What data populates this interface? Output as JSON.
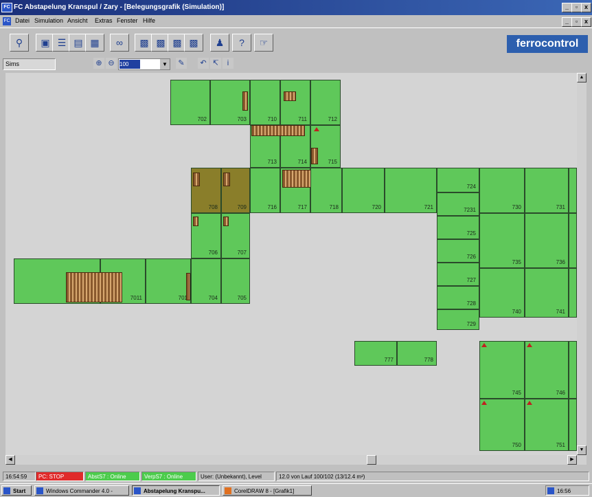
{
  "window": {
    "icon_text": "FC",
    "title": "FC Abstapelung Kranspul / Zary - [Belegungsgrafik (Simulation)]",
    "min_label": "_",
    "max_label": "▫",
    "close_label": "x"
  },
  "menu": {
    "items": [
      "Datei",
      "Simulation",
      "Ansicht",
      "Extras",
      "Fenster",
      "Hilfe"
    ],
    "icon_text": "FC"
  },
  "toolbar": {
    "brand": "ferrocontrol",
    "icons": [
      "search-icon",
      "open-icon",
      "list-icon",
      "print-icon",
      "view-icon",
      "glasses-icon",
      "grid-icon",
      "grid-icon-2",
      "grid-icon-3",
      "grid-icon-4",
      "person-icon",
      "help-icon",
      "exit-icon"
    ]
  },
  "toolbar2": {
    "view_name": "Sims",
    "zoom_value": "100",
    "zoom_dropdown": "▼",
    "icons": [
      "zoom-in-icon",
      "zoom-out-icon",
      "pen-icon",
      "undo-icon",
      "path-icon",
      "info-icon"
    ]
  },
  "cells": [
    {
      "id": "702",
      "label": "702"
    },
    {
      "id": "703",
      "label": "703"
    },
    {
      "id": "710",
      "label": "710"
    },
    {
      "id": "711",
      "label": "711"
    },
    {
      "id": "712",
      "label": "712"
    },
    {
      "id": "713",
      "label": "713"
    },
    {
      "id": "714",
      "label": "714"
    },
    {
      "id": "715",
      "label": "715"
    },
    {
      "id": "708",
      "label": "708"
    },
    {
      "id": "709",
      "label": "709"
    },
    {
      "id": "716",
      "label": "716"
    },
    {
      "id": "717",
      "label": "717"
    },
    {
      "id": "718",
      "label": "718"
    },
    {
      "id": "720",
      "label": "720"
    },
    {
      "id": "721",
      "label": "721"
    },
    {
      "id": "706",
      "label": "706"
    },
    {
      "id": "707",
      "label": "707"
    },
    {
      "id": "7011",
      "label": "7011"
    },
    {
      "id": "701",
      "label": "701"
    },
    {
      "id": "704",
      "label": "704"
    },
    {
      "id": "705",
      "label": "705"
    },
    {
      "id": "724",
      "label": "724"
    },
    {
      "id": "7231",
      "label": "7231"
    },
    {
      "id": "725",
      "label": "725"
    },
    {
      "id": "726",
      "label": "726"
    },
    {
      "id": "727",
      "label": "727"
    },
    {
      "id": "728",
      "label": "728"
    },
    {
      "id": "729",
      "label": "729"
    },
    {
      "id": "730",
      "label": "730"
    },
    {
      "id": "731",
      "label": "731"
    },
    {
      "id": "735",
      "label": "735"
    },
    {
      "id": "736",
      "label": "736"
    },
    {
      "id": "740",
      "label": "740"
    },
    {
      "id": "741",
      "label": "741"
    },
    {
      "id": "777",
      "label": "777"
    },
    {
      "id": "778",
      "label": "778"
    },
    {
      "id": "745",
      "label": "745"
    },
    {
      "id": "746",
      "label": "746"
    },
    {
      "id": "750",
      "label": "750"
    },
    {
      "id": "751",
      "label": "751"
    }
  ],
  "statusbar": {
    "time": "16:54:59",
    "pc_state": "PC: STOP",
    "abst": "AbstS7 : Online",
    "verp": "VerpS7 : Online",
    "user": "User: (Unbekannt), Level",
    "info": "12.0 von Lauf 100/102 (13/12.4 m²)"
  },
  "colors": {
    "cell_green": "#5fc85a",
    "cell_olive": "#8a7e2a",
    "status_red": "#e02a2a",
    "status_green": "#4ccc4c",
    "brand_blue": "#2d5fae"
  },
  "taskbar": {
    "start": "Start",
    "tasks": [
      "Windows Commander 4.0 -",
      "Abstapelung Kranspu...",
      "CorelDRAW 8 - [Grafik1]"
    ],
    "tray_time": "16:56"
  }
}
